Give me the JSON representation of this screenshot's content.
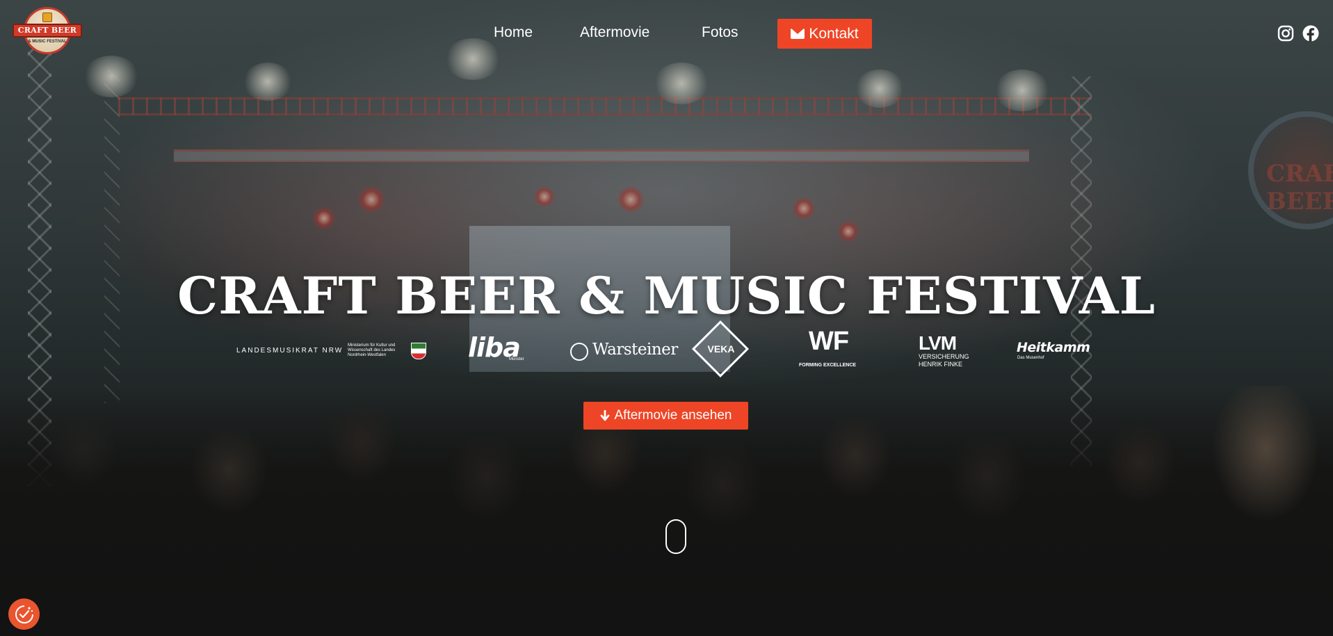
{
  "brand": {
    "logo_title": "CRAFT BEER",
    "logo_subtitle": "& MUSIC FESTIVAL"
  },
  "nav": {
    "items": [
      {
        "label": "Home"
      },
      {
        "label": "Aftermovie"
      },
      {
        "label": "Fotos"
      }
    ],
    "contact_label": "Kontakt"
  },
  "social": {
    "icons": [
      "instagram-icon",
      "facebook-icon"
    ]
  },
  "hero": {
    "title": "CRAFT BEER & MUSIC FESTIVAL",
    "cta_label": "Aftermovie ansehen"
  },
  "sponsors": {
    "landesmusikrat": "LANDESMUSIKRAT NRW",
    "ministerium": "Ministerium für Kultur und Wissenschaft des Landes Nordrhein-Westfalen",
    "liba": "liba",
    "liba_sub": "Münster",
    "warsteiner": "Warsteiner",
    "veka": "VEKA",
    "wf": "WF",
    "wf_sub": "FORMING EXCELLENCE",
    "lvm": "LVM",
    "lvm_sub1": "VERSICHERUNG",
    "lvm_sub2": "HENRIK FINKE",
    "heitkamm": "Heitkamm",
    "heitkamm_sub": "Das Musenhof"
  },
  "colors": {
    "accent": "#ee4526",
    "text": "#ffffff"
  }
}
